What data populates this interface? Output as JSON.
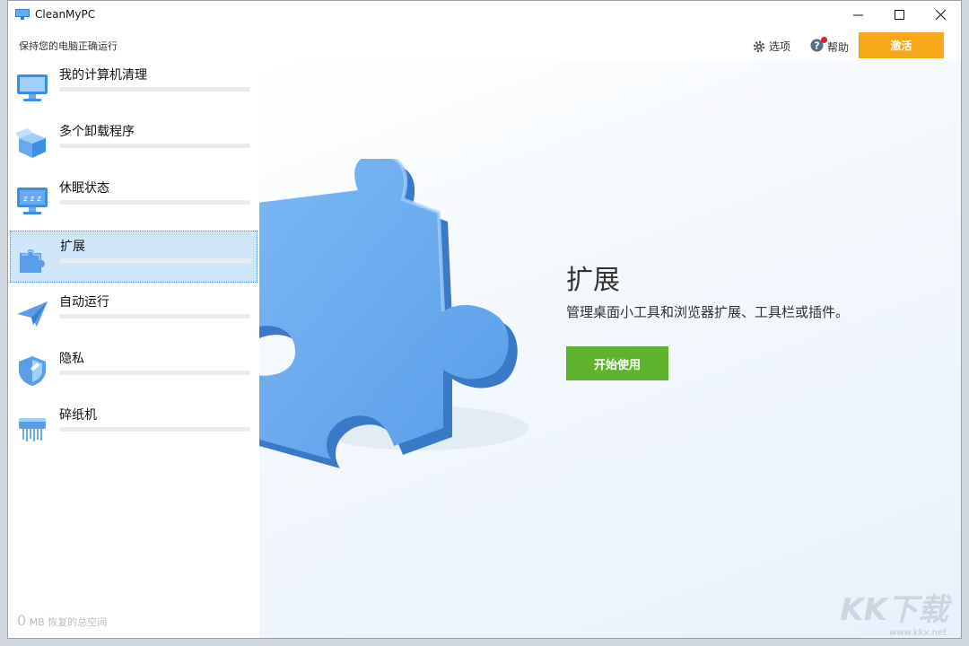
{
  "window": {
    "title": "CleanMyPC",
    "subtitle": "保持您的电脑正确运行"
  },
  "topbar": {
    "options_label": "选项",
    "help_label": "帮助",
    "activate_label": "激活"
  },
  "sidebar": {
    "items": [
      {
        "label": "我的计算机清理",
        "icon": "computer-icon"
      },
      {
        "label": "多个卸载程序",
        "icon": "box-icon"
      },
      {
        "label": "休眠状态",
        "icon": "sleep-monitor-icon"
      },
      {
        "label": "扩展",
        "icon": "puzzle-icon",
        "selected": true
      },
      {
        "label": "自动运行",
        "icon": "paper-plane-icon"
      },
      {
        "label": "隐私",
        "icon": "shield-icon"
      },
      {
        "label": "碎纸机",
        "icon": "shredder-icon"
      }
    ],
    "recovered_amount": "0",
    "recovered_unit": "MB",
    "recovered_label": "恢复的总空间"
  },
  "main": {
    "title": "扩展",
    "description": "管理桌面小工具和浏览器扩展、工具栏或插件。",
    "start_button": "开始使用"
  },
  "watermark": {
    "text": "KK下载",
    "url": "www.kkx.net"
  },
  "colors": {
    "activate": "#f7a81a",
    "start": "#5eb32d",
    "selected": "#cfe6fb",
    "puzzle": "#6aa9ee"
  }
}
